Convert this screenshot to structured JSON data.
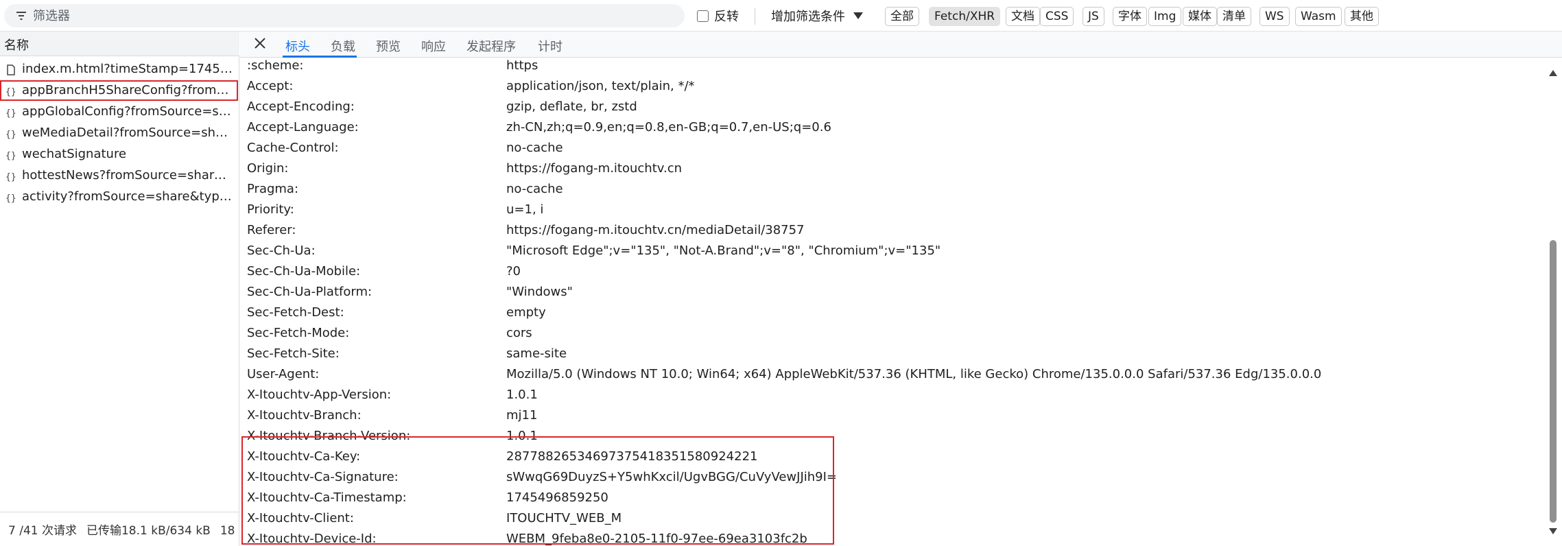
{
  "filterbar": {
    "placeholder": "筛选器",
    "invert_label": "反转",
    "more_filters_label": "增加筛选条件",
    "type_filters": [
      "全部",
      "Fetch/XHR",
      "文档",
      "CSS",
      "JS",
      "字体",
      "Img",
      "媒体",
      "清单",
      "WS",
      "Wasm",
      "其他"
    ],
    "active_type": "Fetch/XHR"
  },
  "list": {
    "name_header": "名称",
    "requests": [
      {
        "name": "index.m.html?timeStamp=174549...",
        "icon": "document-icon"
      },
      {
        "name": "appBranchH5ShareConfig?fromSo...",
        "icon": "xhr-icon",
        "selected": true
      },
      {
        "name": "appGlobalConfig?fromSource=sh...",
        "icon": "xhr-icon"
      },
      {
        "name": "weMediaDetail?fromSource=shar...",
        "icon": "xhr-icon"
      },
      {
        "name": "wechatSignature",
        "icon": "xhr-icon"
      },
      {
        "name": "hottestNews?fromSource=share&...",
        "icon": "xhr-icon"
      },
      {
        "name": "activity?fromSource=share&type=1",
        "icon": "xhr-icon"
      }
    ],
    "status": {
      "requests": "7 /41 次请求",
      "transferred": "已传输18.1 kB/634 kB",
      "extra": "18"
    }
  },
  "details": {
    "tabs": [
      "标头",
      "负载",
      "预览",
      "响应",
      "发起程序",
      "计时"
    ],
    "active_tab": "标头",
    "headers": [
      {
        "key": ":scheme:",
        "value": "https"
      },
      {
        "key": "Accept:",
        "value": "application/json, text/plain, */*"
      },
      {
        "key": "Accept-Encoding:",
        "value": "gzip, deflate, br, zstd"
      },
      {
        "key": "Accept-Language:",
        "value": "zh-CN,zh;q=0.9,en;q=0.8,en-GB;q=0.7,en-US;q=0.6"
      },
      {
        "key": "Cache-Control:",
        "value": "no-cache"
      },
      {
        "key": "Origin:",
        "value": "https://fogang-m.itouchtv.cn"
      },
      {
        "key": "Pragma:",
        "value": "no-cache"
      },
      {
        "key": "Priority:",
        "value": "u=1, i"
      },
      {
        "key": "Referer:",
        "value": "https://fogang-m.itouchtv.cn/mediaDetail/38757"
      },
      {
        "key": "Sec-Ch-Ua:",
        "value": "\"Microsoft Edge\";v=\"135\", \"Not-A.Brand\";v=\"8\", \"Chromium\";v=\"135\""
      },
      {
        "key": "Sec-Ch-Ua-Mobile:",
        "value": "?0"
      },
      {
        "key": "Sec-Ch-Ua-Platform:",
        "value": "\"Windows\""
      },
      {
        "key": "Sec-Fetch-Dest:",
        "value": "empty"
      },
      {
        "key": "Sec-Fetch-Mode:",
        "value": "cors"
      },
      {
        "key": "Sec-Fetch-Site:",
        "value": "same-site"
      },
      {
        "key": "User-Agent:",
        "value": "Mozilla/5.0 (Windows NT 10.0; Win64; x64) AppleWebKit/537.36 (KHTML, like Gecko) Chrome/135.0.0.0 Safari/537.36 Edg/135.0.0.0"
      },
      {
        "key": "X-Itouchtv-App-Version:",
        "value": "1.0.1"
      },
      {
        "key": "X-Itouchtv-Branch:",
        "value": "mj11"
      },
      {
        "key": "X-Itouchtv-Branch-Version:",
        "value": "1.0.1"
      },
      {
        "key": "X-Itouchtv-Ca-Key:",
        "value": "28778826534697375418351580924221"
      },
      {
        "key": "X-Itouchtv-Ca-Signature:",
        "value": "sWwqG69DuyzS+Y5whKxcil/UgvBGG/CuVyVewJJih9I="
      },
      {
        "key": "X-Itouchtv-Ca-Timestamp:",
        "value": "1745496859250"
      },
      {
        "key": "X-Itouchtv-Client:",
        "value": "ITOUCHTV_WEB_M"
      },
      {
        "key": "X-Itouchtv-Device-Id:",
        "value": "WEBM_9feba8e0-2105-11f0-97ee-69ea3103fc2b"
      }
    ]
  },
  "colors": {
    "accent": "#1a73e8",
    "highlight": "#d9262b"
  }
}
